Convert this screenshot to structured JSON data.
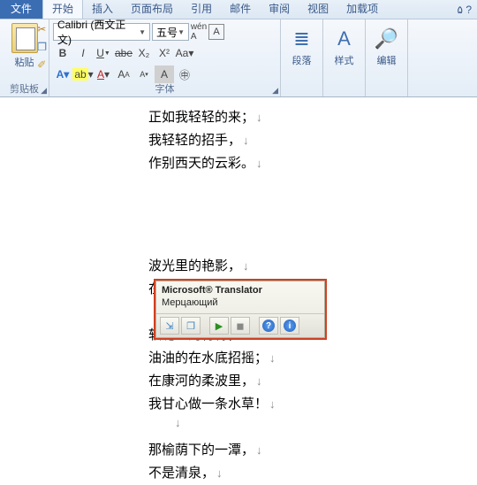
{
  "tabs": {
    "file": "文件",
    "home": "开始",
    "insert": "插入",
    "layout": "页面布局",
    "references": "引用",
    "mail": "邮件",
    "review": "审阅",
    "view": "视图",
    "addins": "加载项"
  },
  "ribbon": {
    "clipboard": {
      "paste": "粘贴",
      "label": "剪贴板"
    },
    "font": {
      "name": "Calibri (西文正文)",
      "size": "五号",
      "label": "字体",
      "bold": "B",
      "italic": "I",
      "underline": "U",
      "strike": "abe",
      "sub": "X₂",
      "sup": "X²",
      "grow": "A",
      "shrink": "A",
      "clear": "Aa",
      "change": "A"
    },
    "paragraph": {
      "label": "段落"
    },
    "styles": {
      "label": "样式"
    },
    "editing": {
      "label": "编辑"
    }
  },
  "document": {
    "lines": [
      "正如我轻轻的来；",
      "我轻轻的招手，",
      "作别西天的云彩。",
      "",
      "",
      "波光里的艳影，",
      "在我的心头荡漾。",
      "",
      "软泥上的青荇，",
      "油油的在水底招摇；",
      "在康河的柔波里，",
      "我甘心做一条水草！",
      "",
      "那榆荫下的一潭，",
      "不是清泉，"
    ]
  },
  "translator": {
    "title": "Microsoft® Translator",
    "result": "Мерцающий",
    "help": "?",
    "info": "i"
  }
}
